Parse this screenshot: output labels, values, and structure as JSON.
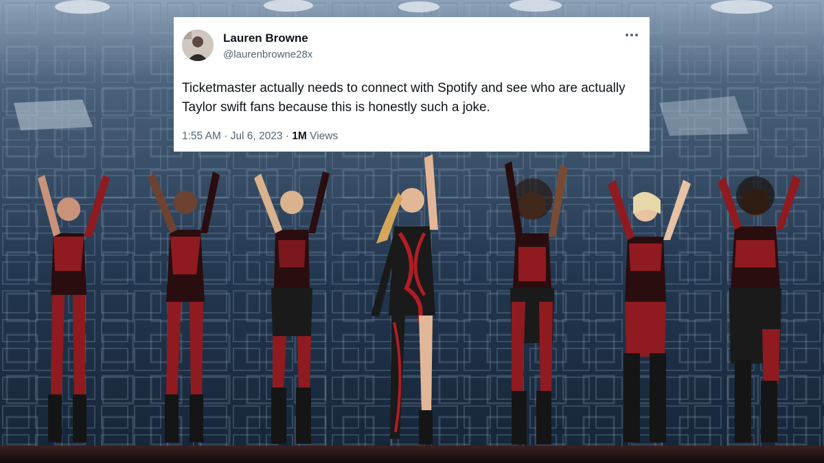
{
  "tweet": {
    "display_name": "Lauren Browne",
    "handle": "@laurenbrowne28x",
    "text": "Ticketmaster actually needs to connect with Spotify and see who are actually Taylor swift fans because this is honestly such a joke.",
    "timestamp": "1:55 AM · Jul 6, 2023",
    "separator": "·",
    "views_count": "1M",
    "views_label": "Views",
    "more_icon": "more-horizontal-icon"
  },
  "colors": {
    "card_bg": "#ffffff",
    "text_primary": "#0f1419",
    "text_secondary": "#536471",
    "stage_blue": "#2a3d55",
    "costume_red": "#a51f25"
  }
}
